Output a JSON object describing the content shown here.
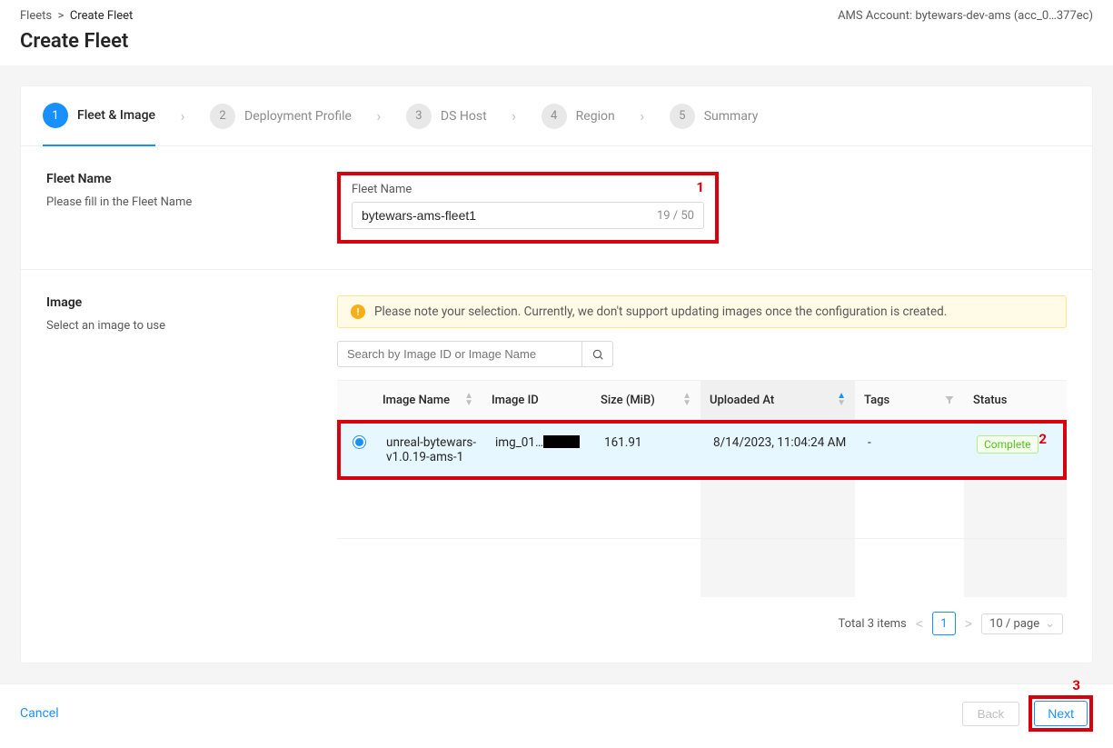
{
  "header": {
    "breadcrumb_root": "Fleets",
    "breadcrumb_current": "Create Fleet",
    "title": "Create Fleet",
    "ams_label": "AMS Account:",
    "ams_value": "bytewars-dev-ams (acc_0…377ec)"
  },
  "steps": [
    {
      "num": "1",
      "label": "Fleet & Image",
      "active": true
    },
    {
      "num": "2",
      "label": "Deployment Profile",
      "active": false
    },
    {
      "num": "3",
      "label": "DS Host",
      "active": false
    },
    {
      "num": "4",
      "label": "Region",
      "active": false
    },
    {
      "num": "5",
      "label": "Summary",
      "active": false
    }
  ],
  "fleet_name_section": {
    "title": "Fleet Name",
    "desc": "Please fill in the Fleet Name",
    "field_label": "Fleet Name",
    "field_value": "bytewars-ams-fleet1",
    "char_counter": "19 / 50",
    "annot": "1"
  },
  "image_section": {
    "title": "Image",
    "desc": "Select an image to use",
    "alert": "Please note your selection. Currently, we don't support updating images once the configuration is created.",
    "search_placeholder": "Search by Image ID or Image Name",
    "annot": "2",
    "columns": {
      "name": "Image Name",
      "id": "Image ID",
      "size": "Size (MiB)",
      "uploaded": "Uploaded At",
      "tags": "Tags",
      "status": "Status"
    },
    "rows": [
      {
        "selected": true,
        "name": "unreal-bytewars-v1.0.19-ams-1",
        "id_prefix": "img_01…",
        "size": "161.91",
        "uploaded": "8/14/2023, 11:04:24 AM",
        "tags": "-",
        "status": "Complete"
      }
    ],
    "pagination": {
      "total_label": "Total 3 items",
      "page": "1",
      "size": "10 / page"
    }
  },
  "footer": {
    "cancel": "Cancel",
    "back": "Back",
    "next": "Next",
    "annot": "3"
  }
}
